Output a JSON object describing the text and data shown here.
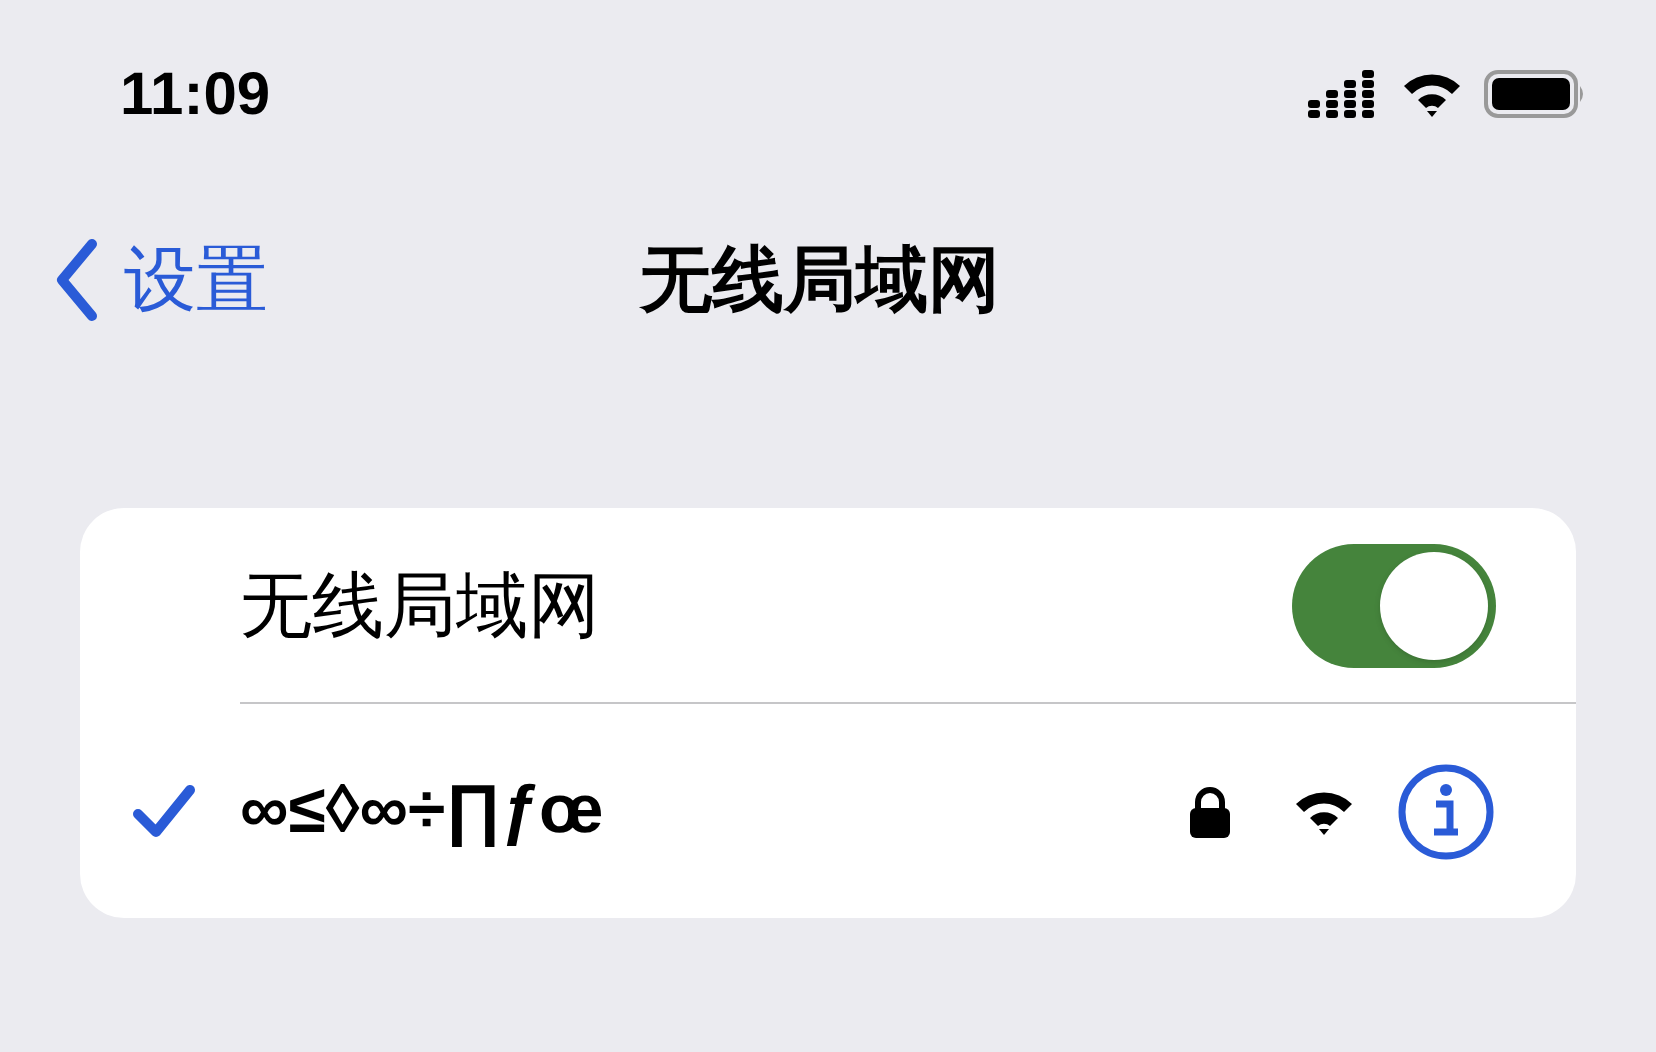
{
  "status_bar": {
    "time": "11:09"
  },
  "nav": {
    "back": "设置",
    "title": "无线局域网"
  },
  "wifi_toggle": {
    "label": "无线局域网",
    "on": true
  },
  "networks": [
    {
      "name": "∞≤◊∞÷∏ƒœ",
      "selected": true,
      "locked": true
    }
  ]
}
